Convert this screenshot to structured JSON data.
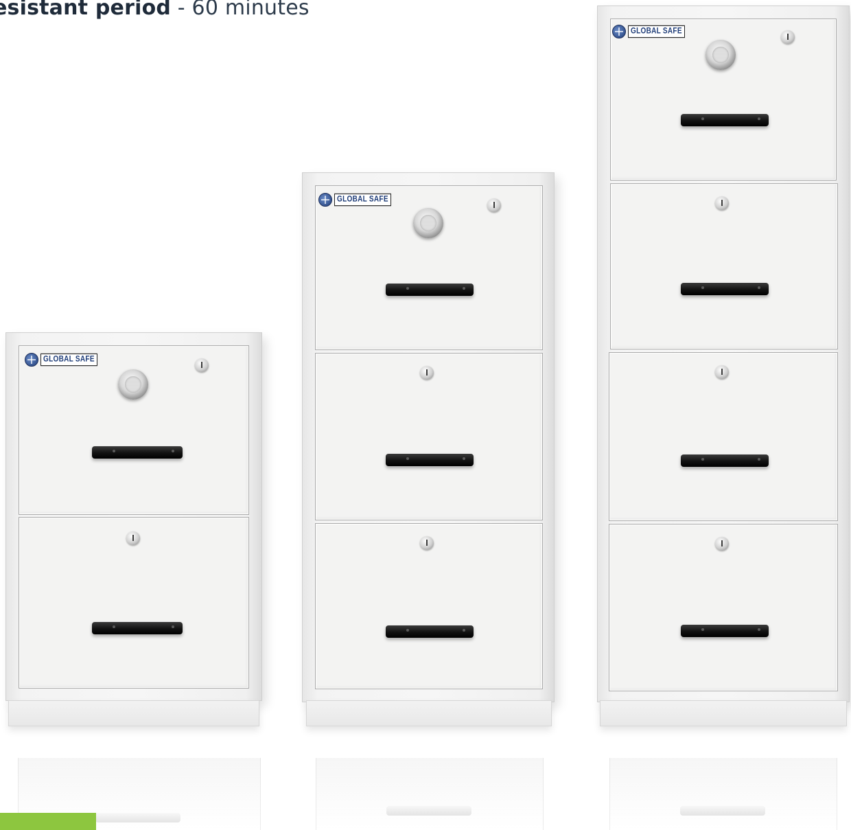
{
  "headline": {
    "bold": "esistant period",
    "rest": " - 60 minutes"
  },
  "brand": {
    "label": "GLOBAL SAFE",
    "color": "#1e3c78"
  },
  "colors": {
    "accent_green": "#8dc63f",
    "cabinet_white": "#f3f3f2",
    "handle_black": "#111111"
  },
  "icons": [
    "globe-logo-icon",
    "combination-dial-icon",
    "key-lock-icon",
    "drawer-handle-icon"
  ]
}
